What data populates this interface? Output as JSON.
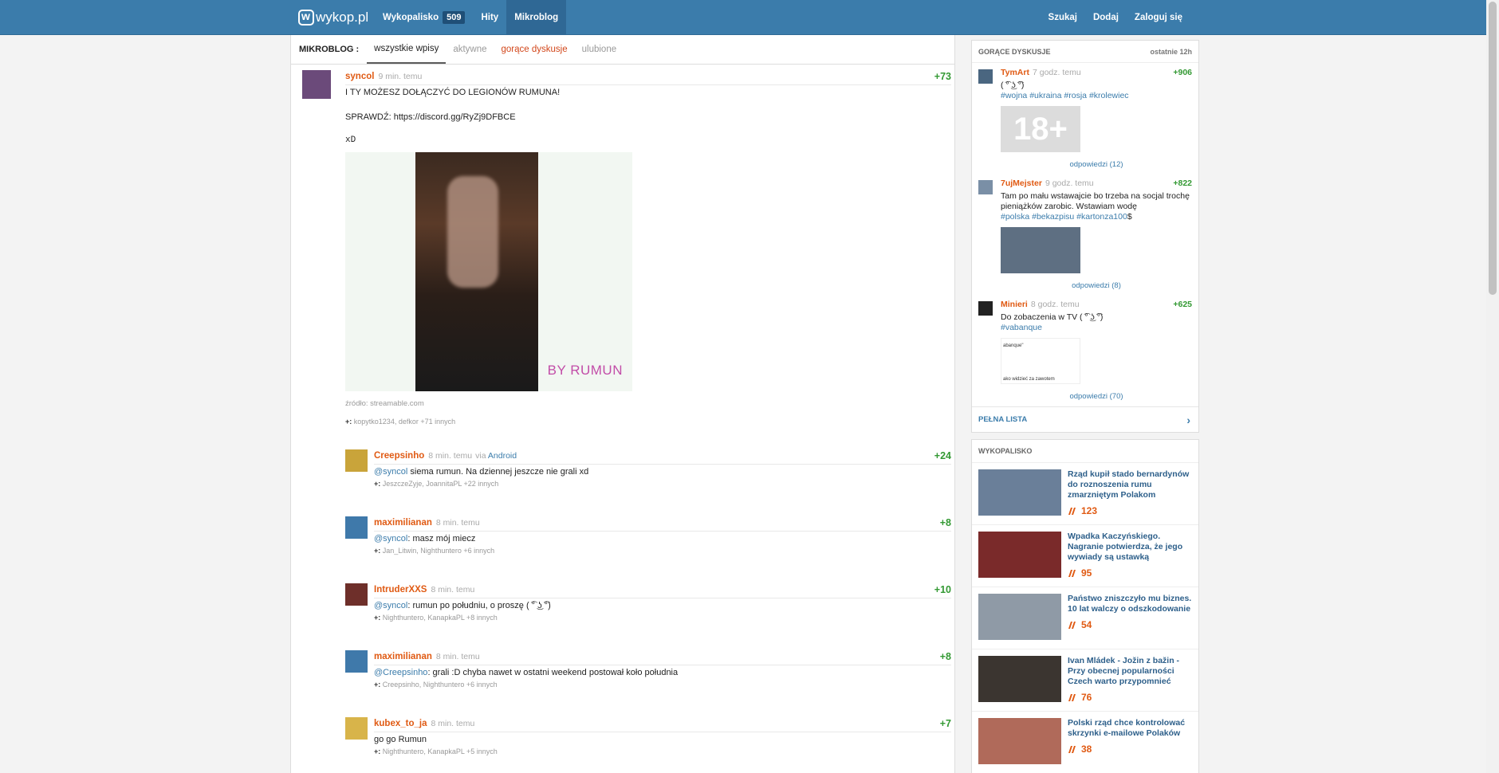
{
  "topbar": {
    "logo": "wykop.pl",
    "nav": [
      {
        "label": "Wykopalisko",
        "count": "509"
      },
      {
        "label": "Hity"
      },
      {
        "label": "Mikroblog"
      }
    ],
    "right": [
      "Szukaj",
      "Dodaj",
      "Zaloguj się"
    ]
  },
  "subnav": {
    "title": "MIKROBLOG :",
    "tabs": [
      "wszystkie wpisy",
      "aktywne",
      "gorące dyskusje",
      "ulubione"
    ]
  },
  "entry": {
    "author": "syncol",
    "time": "9 min. temu",
    "score": "+73",
    "line1": "I TY MOŻESZ DOŁĄCZYĆ DO LEGIONÓW RUMUNA!",
    "line2": "SPRAWDŹ: https://discord.gg/RyZj9DFBCE",
    "line3": "xD",
    "image_watermark": "BY RUMUN",
    "source": "źródło: streamable.com",
    "plus_prefix": "+:",
    "plus_rest": "kopytko1234, defkor +71 innych"
  },
  "comments": [
    {
      "author": "Creepsinho",
      "time": "8 min. temu",
      "via_label": "via",
      "via": "Android",
      "score": "+24",
      "mention": "@syncol",
      "text": " siema rumun. Na dziennej jeszcze nie grali xd",
      "plus": "JeszczeZyje, JoannitaPL +22 innych"
    },
    {
      "author": "maximilianan",
      "time": "8 min. temu",
      "score": "+8",
      "mention": "@syncol",
      "text": ": masz mój miecz",
      "plus": "Jan_Litwin, Nighthuntero +6 innych"
    },
    {
      "author": "IntruderXXS",
      "time": "8 min. temu",
      "score": "+10",
      "mention": "@syncol",
      "text": ": rumun po południu, o proszę ( ͡° ͜ʖ ͡°)",
      "plus": "Nighthuntero, KanapkaPL +8 innych"
    },
    {
      "author": "maximilianan",
      "time": "8 min. temu",
      "score": "+8",
      "mention": "@Creepsinho",
      "text": ": grali :D chyba nawet w ostatni weekend postował koło południa",
      "plus": "Creepsinho, Nighthuntero +6 innych"
    },
    {
      "author": "kubex_to_ja",
      "time": "8 min. temu",
      "score": "+7",
      "mention": "",
      "text": "go go Rumun",
      "plus": "Nighthuntero, KanapkaPL +5 innych"
    }
  ],
  "hot": {
    "title": "GORĄCE DYSKUSJE",
    "period": "ostatnie 12h",
    "items": [
      {
        "author": "TymArt",
        "time": "7 godz. temu",
        "score": "+906",
        "text": "( ͡° ͜ʖ ͡°)",
        "tags": [
          "#wojna",
          "#ukraina",
          "#rosja",
          "#krolewiec"
        ],
        "adult": "18+",
        "replies": "odpowiedzi (12)"
      },
      {
        "author": "7ujMejster",
        "time": "9 godz. temu",
        "score": "+822",
        "text": "Tam po mału wstawajcie bo trzeba na socjal trochę pieniążków zarobic. Wstawiam wodę",
        "tags": [
          "#polska",
          "#bekazpisu",
          "#kartonza100"
        ],
        "suffix": "$",
        "replies": "odpowiedzi (8)"
      },
      {
        "author": "Minieri",
        "time": "8 godz. temu",
        "score": "+625",
        "text": "Do zobaczenia w TV ( ͡° ͜ʖ ͡°)",
        "tags": [
          "#vabanque"
        ],
        "thumb_l1": "abanque\"",
        "thumb_l2": "ako widzieć za zawotem",
        "replies": "odpowiedzi (70)"
      }
    ],
    "full_list": "PEŁNA LISTA"
  },
  "wykopalisko": {
    "title": "WYKOPALISKO",
    "items": [
      {
        "title": "Rząd kupił stado bernardynów do roznoszenia rumu zmarzniętym Polakom",
        "digs": "123",
        "color": "#6a7f99"
      },
      {
        "title": "Wpadka Kaczyńskiego. Nagranie potwierdza, że jego wywiady są ustawką",
        "digs": "95",
        "color": "#7a2a2a"
      },
      {
        "title": "Państwo zniszczyło mu biznes. 10 lat walczy o odszkodowanie",
        "digs": "54",
        "color": "#8f9aa6"
      },
      {
        "title": "Ivan Mládek - Jožin z bažin - Przy obecnej popularności Czech warto przypomnieć",
        "digs": "76",
        "color": "#3b3530"
      },
      {
        "title": "Polski rząd chce kontrolować skrzynki e-mailowe Polaków",
        "digs": "38",
        "color": "#b06a5a"
      }
    ]
  },
  "colors": {
    "accent": "#3b7cab",
    "author": "#e05a13",
    "score": "#339933"
  }
}
